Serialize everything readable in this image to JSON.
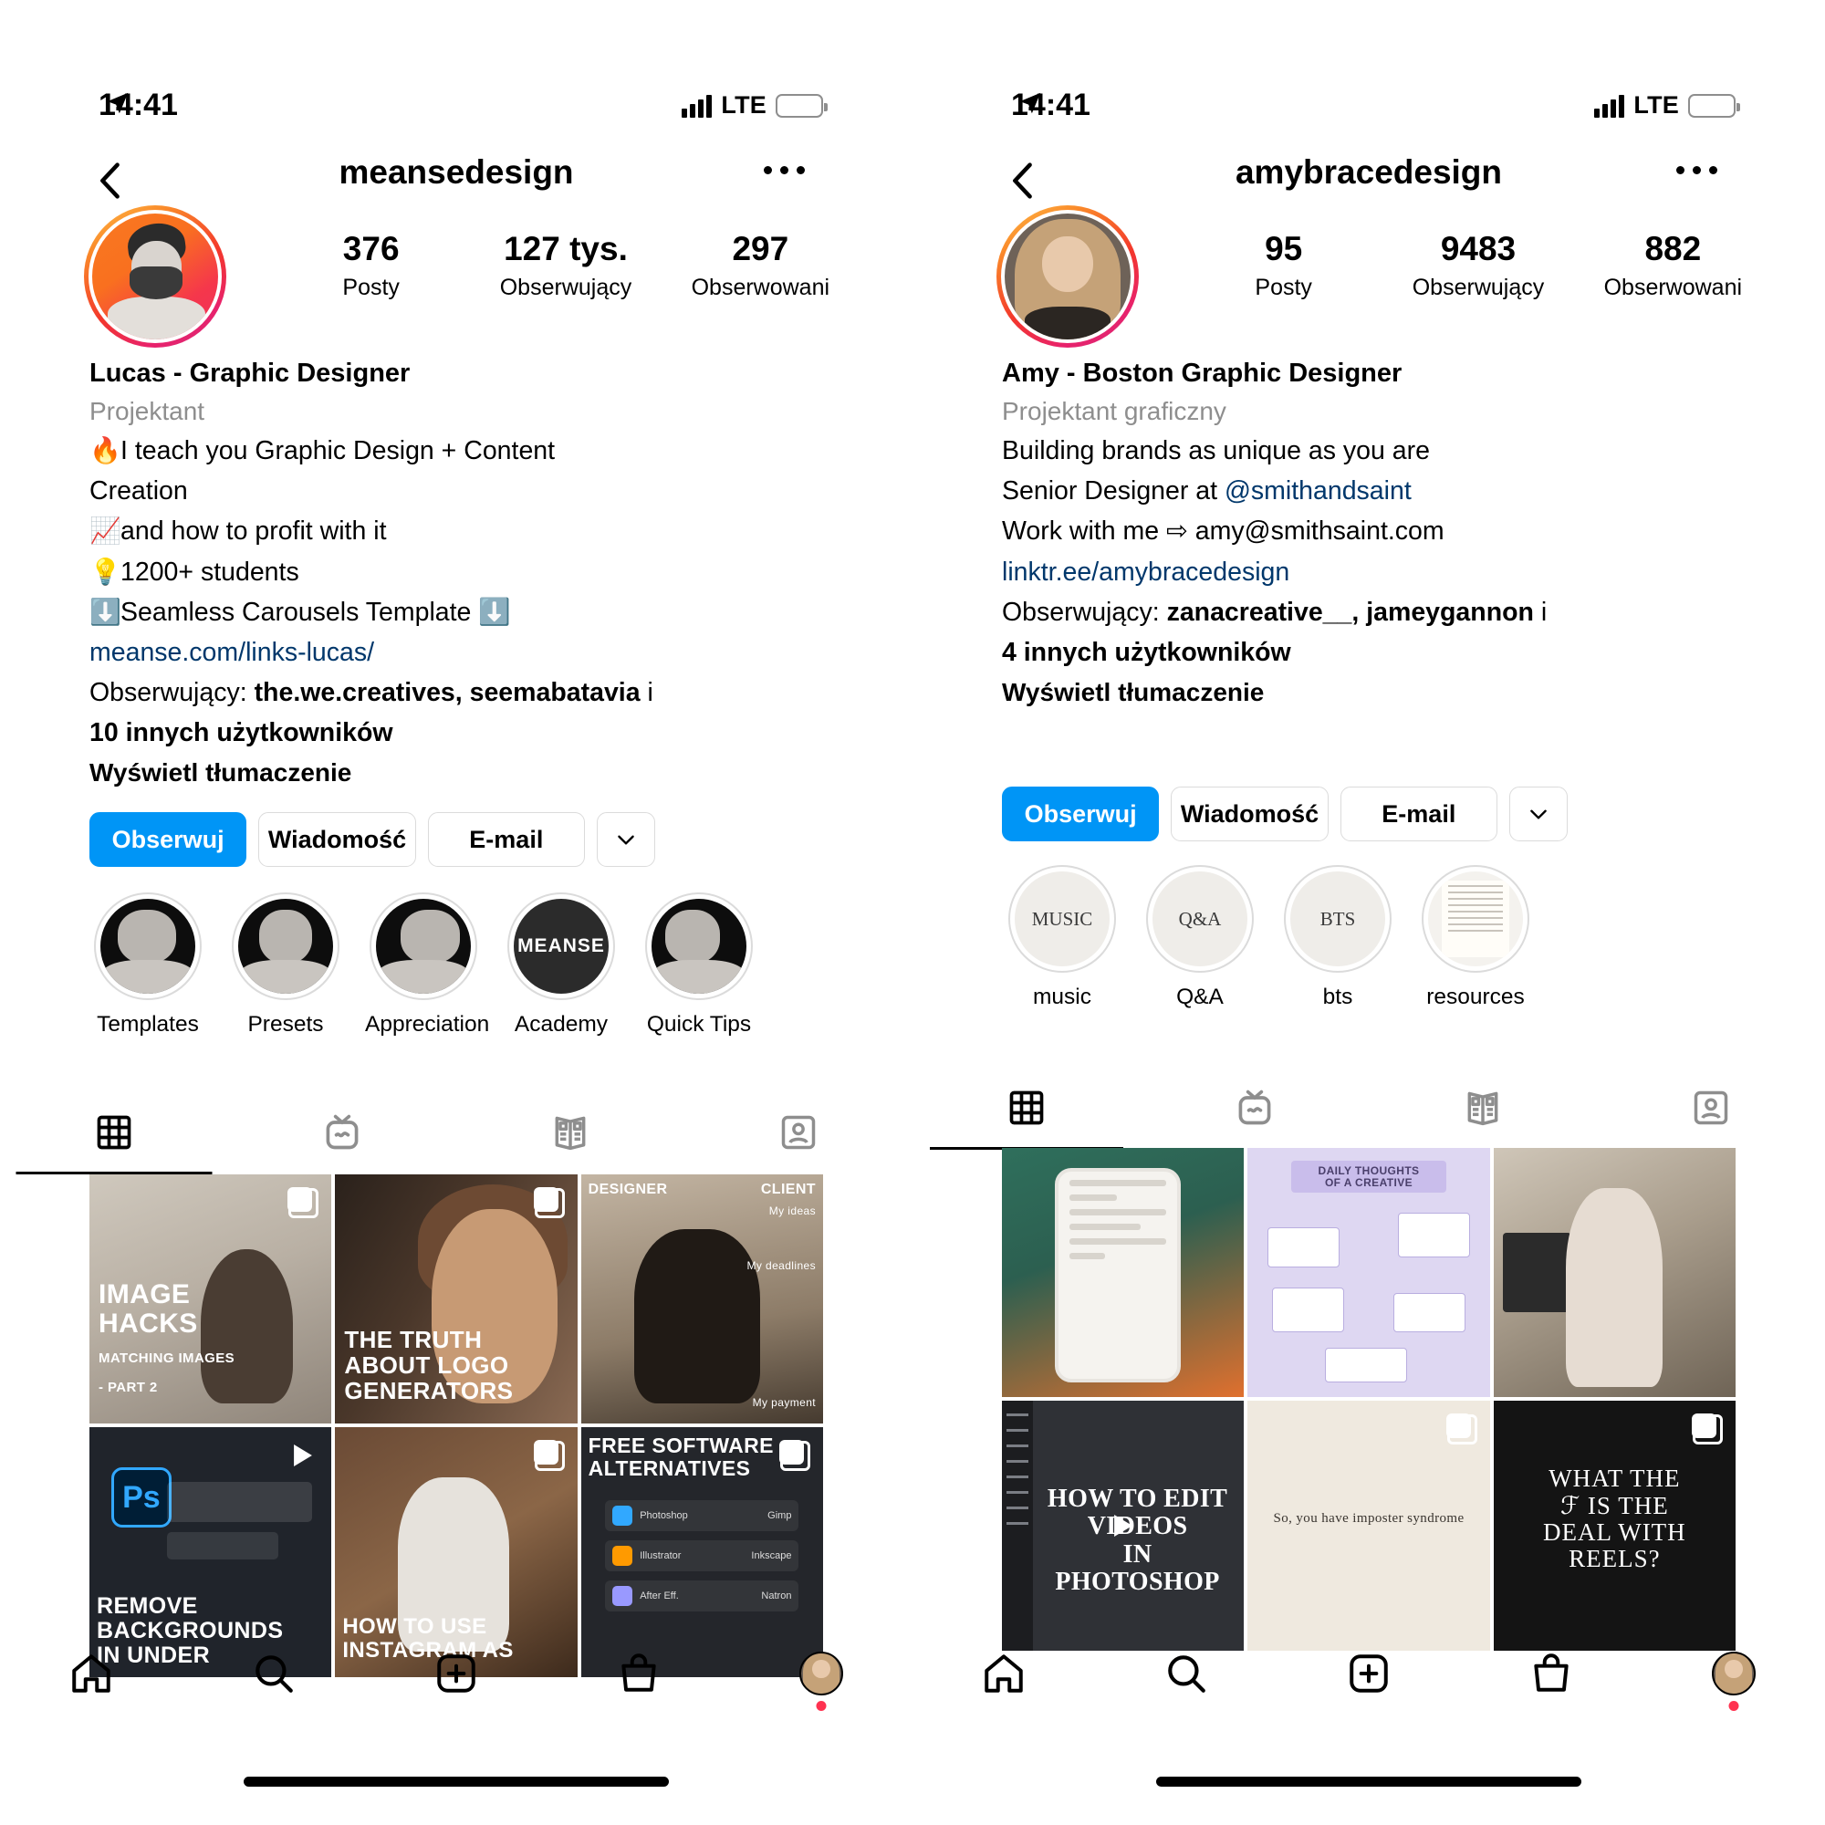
{
  "screens": [
    {
      "status": {
        "time": "14:41",
        "location_icon": "location-arrow-icon",
        "network": "LTE",
        "battery_icon": "battery-low-power-icon"
      },
      "nav": {
        "back_icon": "chevron-left-icon",
        "title": "meansedesign",
        "more_icon": "more-horizontal-icon"
      },
      "profile": {
        "avatar_name": "profile-avatar-lucas",
        "stats": [
          {
            "value": "376",
            "label": "Posty"
          },
          {
            "value": "127 tys.",
            "label": "Obserwujący"
          },
          {
            "value": "297",
            "label": "Obserwowani"
          }
        ],
        "display_name": "Lucas - Graphic Designer",
        "category": "Projektant",
        "bio_lines": [
          {
            "emoji": "🔥",
            "text": "I teach you Graphic Design + Content Creation"
          },
          {
            "emoji": "📈",
            "text": "and how to profit with it"
          },
          {
            "emoji": "💡",
            "text": "1200+ students"
          },
          {
            "emoji": "⬇️",
            "text": "Seamless Carousels Template ⬇️"
          }
        ],
        "link": "meanse.com/links-lucas/",
        "followed_by_prefix": "Obserwujący: ",
        "followed_by_names": "the.we.creatives, seemabatavia",
        "followed_by_middle": " i ",
        "followed_by_more": "10 innych użytkowników",
        "translate": "Wyświetl tłumaczenie"
      },
      "actions": {
        "follow": "Obserwuj",
        "message": "Wiadomość",
        "email": "E-mail",
        "caret_icon": "chevron-down-icon"
      },
      "highlights": [
        {
          "label": "Templates",
          "style": "photo",
          "cover_text": ""
        },
        {
          "label": "Presets",
          "style": "photo",
          "cover_text": ""
        },
        {
          "label": "Appreciation",
          "style": "photo",
          "cover_text": ""
        },
        {
          "label": "Academy",
          "style": "logo",
          "cover_text": "MEANSE"
        },
        {
          "label": "Quick Tips",
          "style": "photo",
          "cover_text": ""
        }
      ],
      "tabs": [
        {
          "name": "grid-tab",
          "icon": "grid-icon",
          "active": true
        },
        {
          "name": "igtv-tab",
          "icon": "igtv-icon",
          "active": false
        },
        {
          "name": "guides-tab",
          "icon": "guides-icon",
          "active": false
        },
        {
          "name": "tagged-tab",
          "icon": "tagged-person-icon",
          "active": false
        }
      ],
      "posts": [
        {
          "art": "t-room",
          "caption": "IMAGE\nHACKS",
          "sub": "MATCHING IMAGES\n- PART 2",
          "indicator": "carousel",
          "align": "bottom-left"
        },
        {
          "art": "t-dark",
          "caption": "THE TRUTH\nABOUT LOGO\nGENERATORS",
          "sub": "",
          "indicator": "carousel",
          "align": "bottom-left"
        },
        {
          "art": "t-int",
          "caption": "DESIGNER        CLIENT",
          "sub": "My ideas / My deadlines / My payment",
          "indicator": "none",
          "align": "top"
        },
        {
          "art": "t-ps",
          "caption": "REMOVE\nBACKGROUNDS\nIN UNDER",
          "sub": "",
          "indicator": "video",
          "align": "bottom-left"
        },
        {
          "art": "t-sofa",
          "caption": "HOW TO USE\nINSTAGRAM AS",
          "sub": "",
          "indicator": "carousel",
          "align": "bottom-left"
        },
        {
          "art": "t-soft",
          "caption": "FREE SOFTWARE\nALTERNATIVES",
          "sub": "Ps Photoshop → Gimp / Ai Illustrator → Inkscape / Ae",
          "indicator": "carousel",
          "align": "top-left"
        }
      ],
      "bottom_nav": [
        {
          "name": "home-tab",
          "icon": "home-icon"
        },
        {
          "name": "search-tab",
          "icon": "search-icon"
        },
        {
          "name": "create-tab",
          "icon": "plus-square-icon"
        },
        {
          "name": "shop-tab",
          "icon": "shopping-bag-icon"
        },
        {
          "name": "profile-tab",
          "icon": "profile-avatar-icon"
        }
      ]
    },
    {
      "status": {
        "time": "14:41",
        "location_icon": "location-arrow-icon",
        "network": "LTE",
        "battery_icon": "battery-low-power-icon"
      },
      "nav": {
        "back_icon": "chevron-left-icon",
        "title": "amybracedesign",
        "more_icon": "more-horizontal-icon"
      },
      "profile": {
        "avatar_name": "profile-avatar-amy",
        "stats": [
          {
            "value": "95",
            "label": "Posty"
          },
          {
            "value": "9483",
            "label": "Obserwujący"
          },
          {
            "value": "882",
            "label": "Obserwowani"
          }
        ],
        "display_name": "Amy - Boston Graphic Designer",
        "category": "Projektant graficzny",
        "bio_lines": [
          {
            "emoji": "",
            "text": "Building brands as unique as you are"
          },
          {
            "emoji": "",
            "text": "Senior Designer at @smithandsaint",
            "mention": "@smithandsaint"
          },
          {
            "emoji": "",
            "text": "Work with me ⇨ amy@smithsaint.com"
          }
        ],
        "link": "linktr.ee/amybracedesign",
        "followed_by_prefix": "Obserwujący: ",
        "followed_by_names": "zanacreative__, jameygannon",
        "followed_by_middle": " i ",
        "followed_by_more": "4 innych użytkowników",
        "translate": "Wyświetl tłumaczenie"
      },
      "actions": {
        "follow": "Obserwuj",
        "message": "Wiadomość",
        "email": "E-mail",
        "caret_icon": "chevron-down-icon"
      },
      "highlights": [
        {
          "label": "music",
          "style": "beige",
          "cover_text": "MUSIC"
        },
        {
          "label": "Q&A",
          "style": "beige",
          "cover_text": "Q&A"
        },
        {
          "label": "bts",
          "style": "beige",
          "cover_text": "BTS"
        },
        {
          "label": "resources",
          "style": "paper",
          "cover_text": ""
        }
      ],
      "tabs": [
        {
          "name": "grid-tab",
          "icon": "grid-icon",
          "active": true
        },
        {
          "name": "igtv-tab",
          "icon": "igtv-icon",
          "active": false
        },
        {
          "name": "guides-tab",
          "icon": "guides-icon",
          "active": false
        },
        {
          "name": "tagged-tab",
          "icon": "tagged-person-icon",
          "active": false
        }
      ],
      "posts": [
        {
          "art": "t-phone",
          "caption": "",
          "sub": "",
          "indicator": "none",
          "align": "none"
        },
        {
          "art": "t-mind",
          "caption": "DAILY THOUGHTS OF A CREATIVE",
          "sub": "",
          "indicator": "none",
          "align": "top"
        },
        {
          "art": "t-desk",
          "caption": "",
          "sub": "",
          "indicator": "none",
          "align": "none"
        },
        {
          "art": "t-tl",
          "caption": "HOW TO EDIT\nVIDEOS\nIN PHOTOSHOP",
          "sub": "",
          "indicator": "video",
          "align": "center"
        },
        {
          "art": "t-cream",
          "caption": "So, you have imposter syndrome",
          "sub": "",
          "indicator": "carousel",
          "align": "center-dark"
        },
        {
          "art": "t-black",
          "caption": "WHAT THE\nℱ IS THE\nDEAL WITH\nREELS?",
          "sub": "",
          "indicator": "carousel",
          "align": "center"
        }
      ],
      "bottom_nav": [
        {
          "name": "home-tab",
          "icon": "home-icon"
        },
        {
          "name": "search-tab",
          "icon": "search-icon"
        },
        {
          "name": "create-tab",
          "icon": "plus-square-icon"
        },
        {
          "name": "shop-tab",
          "icon": "shopping-bag-icon"
        },
        {
          "name": "profile-tab",
          "icon": "profile-avatar-icon"
        }
      ]
    }
  ],
  "colors": {
    "accent_blue": "#0095F6",
    "link_blue": "#00376B",
    "muted": "#8e8e8e",
    "border": "#DBDBDB",
    "battery": "#FFCC00"
  }
}
